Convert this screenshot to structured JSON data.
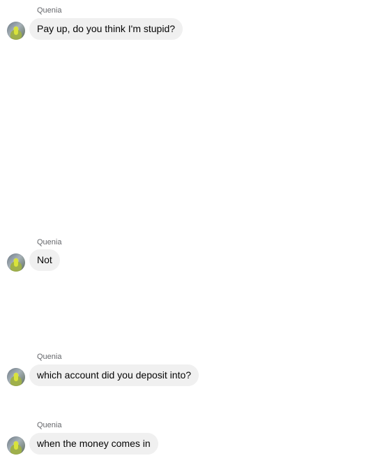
{
  "messages": [
    {
      "sender": "Quenia",
      "text": "Pay up, do you think I'm stupid?"
    },
    {
      "sender": "Quenia",
      "text": "Not"
    },
    {
      "sender": "Quenia",
      "text": "which account did you deposit into?"
    },
    {
      "sender": "Quenia",
      "text": "when the money comes in"
    }
  ],
  "colors": {
    "bubble_bg": "#f0f0f0",
    "sender_text": "#65676b",
    "message_text": "#050505"
  },
  "icons": {
    "avatar": "avatar-icon"
  }
}
